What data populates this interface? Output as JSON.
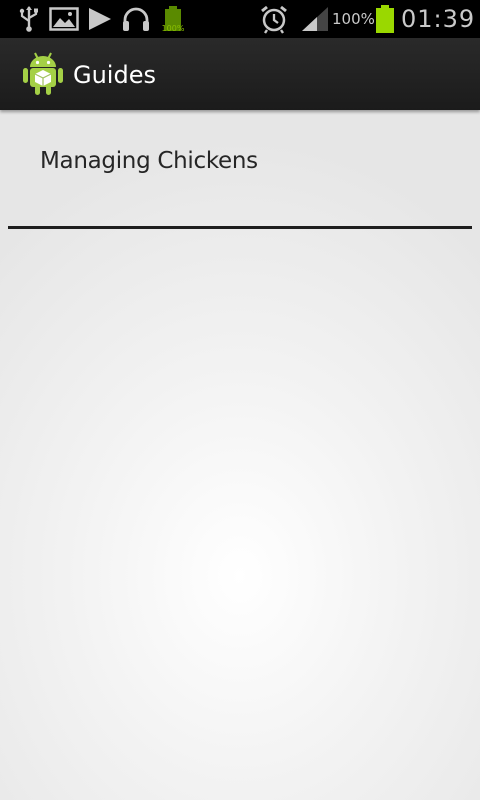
{
  "status_bar": {
    "notification_icons": [
      "usb-icon",
      "gallery-icon",
      "play-icon",
      "headphones-icon",
      "battery-charging-icon"
    ],
    "mini_battery_label": "100%",
    "battery_percent": "100%",
    "clock": "01:39"
  },
  "action_bar": {
    "title": "Guides"
  },
  "list": {
    "items": [
      {
        "label": "Managing Chickens"
      }
    ]
  },
  "colors": {
    "status_bar_bg": "#000000",
    "action_bar_bg": "#1f1f1f",
    "battery_green": "#9ad800",
    "android_green": "#8bc34a",
    "divider": "#1e1e1e"
  }
}
